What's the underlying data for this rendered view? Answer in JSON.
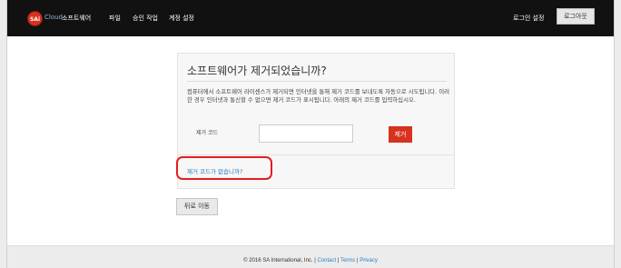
{
  "topbar": {
    "logo_text": "SAi",
    "brand": "Cloud",
    "nav": [
      "소프트웨어",
      "파일",
      "승인 작업",
      "계정 설정"
    ],
    "login_settings": "로그인 설정",
    "logout": "로그아웃"
  },
  "card": {
    "title": "소프트웨어가 제거되었습니까?",
    "description": "컴퓨터에서 소프트웨어 라이센스가 제거되면 인터넷을 통해 제거 코드를 보내도록 자동으로 시도됩니다. 이러한 경우 인터넷과 통신할 수 없으면 제거 코드가 표시됩니다. 아래의 제거 코드를 입력하십시오.",
    "code_label": "제거 코드",
    "code_value": "",
    "remove_button": "제거",
    "no_code_link": "제거 코드가 없습니까?"
  },
  "back_button": "뒤로 이동",
  "footer": {
    "copyright": "© 2016 SA International, Inc. |",
    "contact": "Contact",
    "sep": "|",
    "terms": "Terms",
    "sep2": "|",
    "privacy": "Privacy"
  },
  "colors": {
    "accent_red": "#d6321e",
    "link_blue": "#2b7fc1",
    "topbar": "#111111",
    "highlight": "#e02020"
  }
}
